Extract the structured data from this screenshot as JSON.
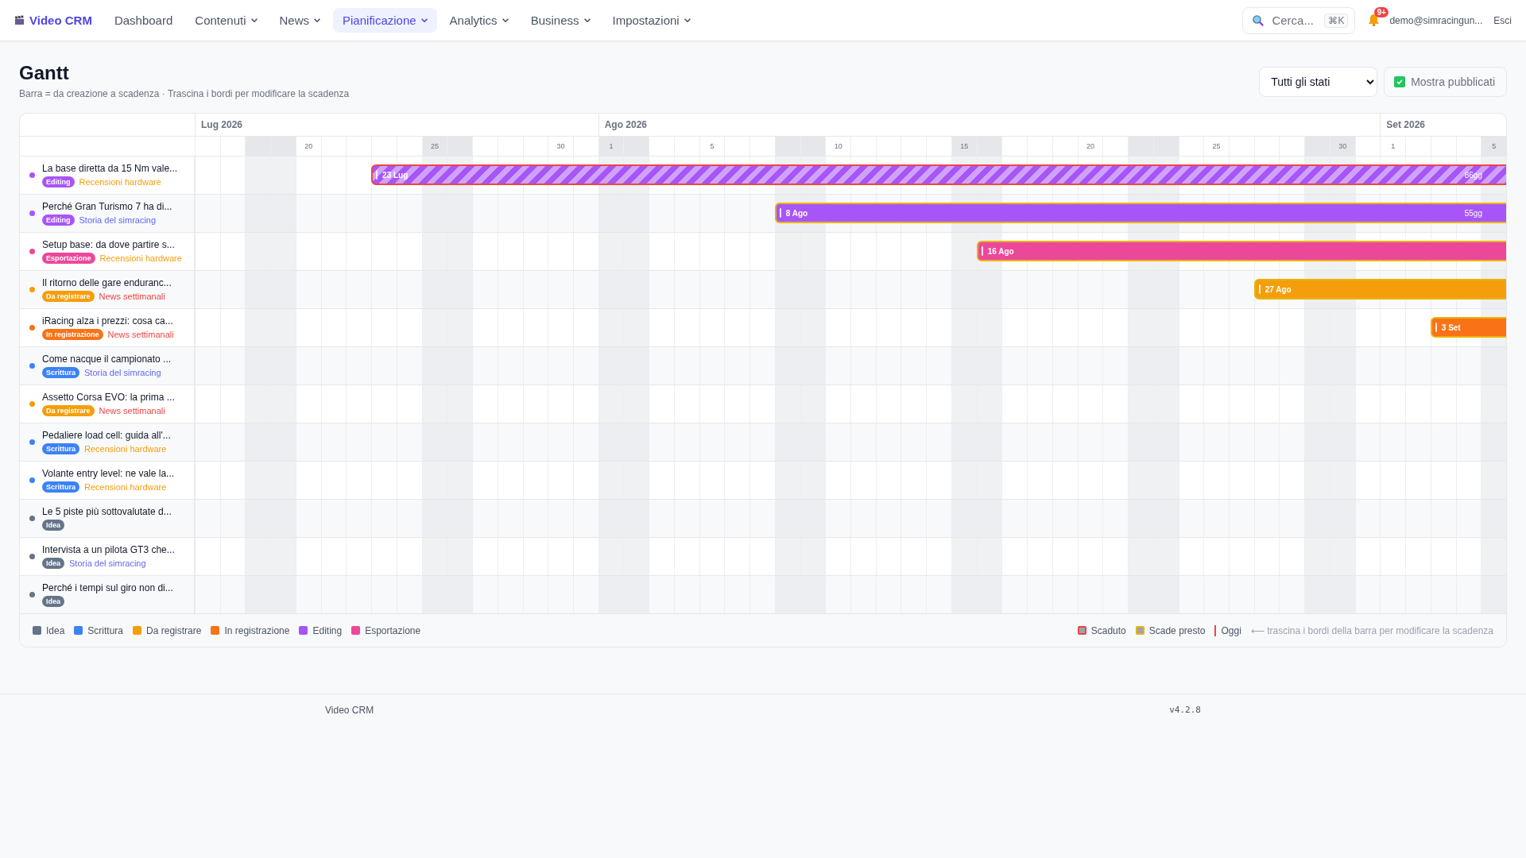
{
  "nav": {
    "brand": "Video CRM",
    "items": [
      {
        "label": "Dashboard",
        "dropdown": false,
        "selected": false
      },
      {
        "label": "Contenuti",
        "dropdown": true,
        "selected": false
      },
      {
        "label": "News",
        "dropdown": true,
        "selected": false
      },
      {
        "label": "Pianificazione",
        "dropdown": true,
        "selected": true
      },
      {
        "label": "Analytics",
        "dropdown": true,
        "selected": false
      },
      {
        "label": "Business",
        "dropdown": true,
        "selected": false
      },
      {
        "label": "Impostazioni",
        "dropdown": true,
        "selected": false
      }
    ],
    "search": {
      "placeholder": "Cerca...",
      "shortcut": "⌘K"
    },
    "notifications": "9+",
    "user": "demo@simracingun...",
    "logout": "Esci"
  },
  "header": {
    "title": "Gantt",
    "subtitle": "Barra = da creazione a scadenza · Trascina i bordi per modificare la scadenza",
    "status_filter": "Tutti gli stati",
    "show_published": {
      "label": "Mostra pubblicati",
      "checked": true
    }
  },
  "timeline": {
    "months": [
      {
        "label": "Lug 2026",
        "days": [
          {
            "weekend": false
          },
          {
            "weekend": false
          },
          {
            "weekend": true
          },
          {
            "weekend": true
          },
          {
            "label": "20",
            "weekend": false
          },
          {
            "weekend": false
          },
          {
            "weekend": false
          },
          {
            "weekend": false
          },
          {
            "weekend": false
          },
          {
            "label": "25",
            "weekend": true
          },
          {
            "weekend": true
          },
          {
            "weekend": false
          },
          {
            "weekend": false
          },
          {
            "weekend": false
          },
          {
            "label": "30",
            "weekend": false
          },
          {
            "weekend": false
          }
        ]
      },
      {
        "label": "Ago 2026",
        "days": [
          {
            "label": "1",
            "weekend": true
          },
          {
            "weekend": true
          },
          {
            "weekend": false
          },
          {
            "weekend": false
          },
          {
            "label": "5",
            "weekend": false
          },
          {
            "weekend": false
          },
          {
            "weekend": false
          },
          {
            "weekend": true
          },
          {
            "weekend": true
          },
          {
            "label": "10",
            "weekend": false
          },
          {
            "weekend": false
          },
          {
            "weekend": false
          },
          {
            "weekend": false
          },
          {
            "weekend": false
          },
          {
            "label": "15",
            "weekend": true
          },
          {
            "weekend": true
          },
          {
            "weekend": false
          },
          {
            "weekend": false
          },
          {
            "weekend": false
          },
          {
            "label": "20",
            "weekend": false
          },
          {
            "weekend": false
          },
          {
            "weekend": true
          },
          {
            "weekend": true
          },
          {
            "weekend": false
          },
          {
            "label": "25",
            "weekend": false
          },
          {
            "weekend": false
          },
          {
            "weekend": false
          },
          {
            "weekend": false
          },
          {
            "weekend": true
          },
          {
            "label": "30",
            "weekend": true
          },
          {
            "weekend": false
          }
        ]
      },
      {
        "label": "Set 2026",
        "days": [
          {
            "label": "1",
            "weekend": false
          },
          {
            "weekend": false
          },
          {
            "weekend": false
          },
          {
            "weekend": false
          },
          {
            "label": "5",
            "weekend": true
          }
        ]
      }
    ]
  },
  "rows": [
    {
      "title": "La base diretta da 15 Nm vale...",
      "color": "#a855f7",
      "status": {
        "label": "Editing",
        "color": "#a855f7"
      },
      "category": {
        "label": "Recensioni hardware",
        "color": "#f59e0b"
      },
      "bar": {
        "label": "23 Lug",
        "duration": "86gg",
        "overdue": true,
        "due_soon": false
      }
    },
    {
      "title": "Perché Gran Turismo 7 ha di...",
      "color": "#a855f7",
      "status": {
        "label": "Editing",
        "color": "#a855f7"
      },
      "category": {
        "label": "Storia del simracing",
        "color": "#6366f1"
      },
      "bar": {
        "label": "8 Ago",
        "duration": "55gg",
        "overdue": false,
        "due_soon": true
      }
    },
    {
      "title": "Setup base: da dove partire s...",
      "color": "#ec4899",
      "status": {
        "label": "Esportazione",
        "color": "#ec4899"
      },
      "category": {
        "label": "Recensioni hardware",
        "color": "#f59e0b"
      },
      "bar": {
        "label": "16 Ago",
        "overdue": false,
        "due_soon": true
      }
    },
    {
      "title": "Il ritorno delle gare enduranc...",
      "color": "#f59e0b",
      "status": {
        "label": "Da registrare",
        "color": "#f59e0b"
      },
      "category": {
        "label": "News settimanali",
        "color": "#ef4444"
      },
      "bar": {
        "label": "27 Ago",
        "overdue": false,
        "due_soon": true
      }
    },
    {
      "title": "iRacing alza i prezzi: cosa ca...",
      "color": "#f97316",
      "status": {
        "label": "In registrazione",
        "color": "#f97316"
      },
      "category": {
        "label": "News settimanali",
        "color": "#ef4444"
      },
      "bar": {
        "label": "3 Set",
        "overdue": false,
        "due_soon": true
      }
    },
    {
      "title": "Come nacque il campionato ...",
      "color": "#3b82f6",
      "status": {
        "label": "Scrittura",
        "color": "#3b82f6"
      },
      "category": {
        "label": "Storia del simracing",
        "color": "#6366f1"
      }
    },
    {
      "title": "Assetto Corsa EVO: la prima ...",
      "color": "#f59e0b",
      "status": {
        "label": "Da registrare",
        "color": "#f59e0b"
      },
      "category": {
        "label": "News settimanali",
        "color": "#ef4444"
      }
    },
    {
      "title": "Pedaliere load cell: guida all'...",
      "color": "#3b82f6",
      "status": {
        "label": "Scrittura",
        "color": "#3b82f6"
      },
      "category": {
        "label": "Recensioni hardware",
        "color": "#f59e0b"
      }
    },
    {
      "title": "Volante entry level: ne vale la...",
      "color": "#3b82f6",
      "status": {
        "label": "Scrittura",
        "color": "#3b82f6"
      },
      "category": {
        "label": "Recensioni hardware",
        "color": "#f59e0b"
      }
    },
    {
      "title": "Le 5 piste più sottovalutate d...",
      "color": "#64748b",
      "status": {
        "label": "Idea",
        "color": "#64748b"
      }
    },
    {
      "title": "Intervista a un pilota GT3 che...",
      "color": "#64748b",
      "status": {
        "label": "Idea",
        "color": "#64748b"
      },
      "category": {
        "label": "Storia del simracing",
        "color": "#6366f1"
      }
    },
    {
      "title": "Perché i tempi sul giro non di...",
      "color": "#64748b",
      "status": {
        "label": "Idea",
        "color": "#64748b"
      }
    }
  ],
  "legend": {
    "statuses": [
      {
        "label": "Idea",
        "color": "#64748b"
      },
      {
        "label": "Scrittura",
        "color": "#3b82f6"
      },
      {
        "label": "Da registrare",
        "color": "#f59e0b"
      },
      {
        "label": "In registrazione",
        "color": "#f97316"
      },
      {
        "label": "Editing",
        "color": "#a855f7"
      },
      {
        "label": "Esportazione",
        "color": "#ec4899"
      }
    ],
    "markers": [
      {
        "kind": "overdue",
        "label": "Scaduto"
      },
      {
        "kind": "due_soon",
        "label": "Scade presto"
      },
      {
        "kind": "today",
        "label": "Oggi"
      }
    ],
    "hint": "⟵ trascina i bordi della barra per modificare la scadenza"
  },
  "footer": {
    "brand": "Video CRM",
    "version": "v4.2.8"
  }
}
